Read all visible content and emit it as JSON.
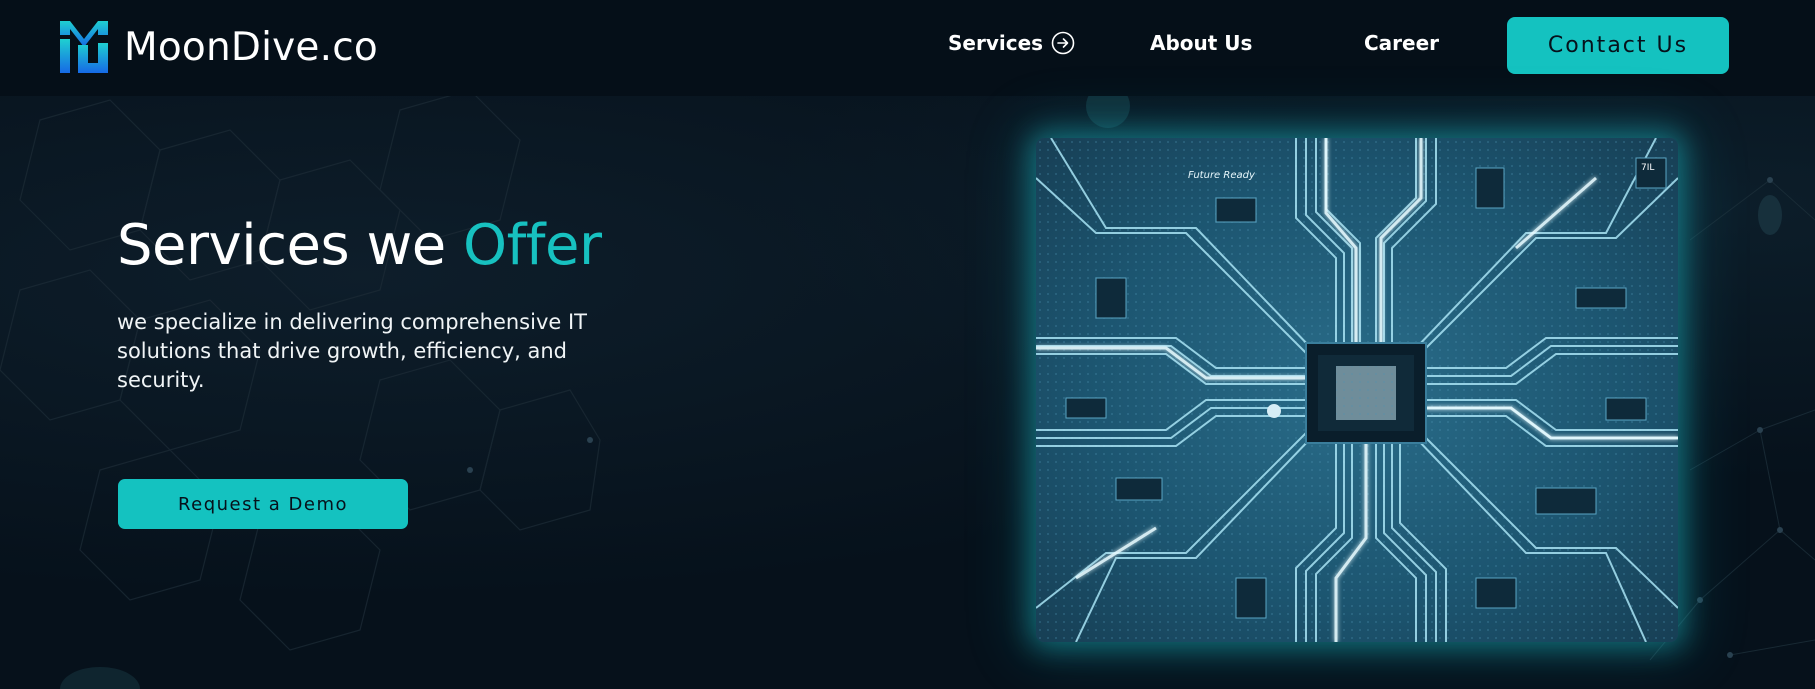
{
  "brand": {
    "name": "MoonDive.co",
    "logo_icon": "moondive-logo-icon"
  },
  "nav": {
    "services": "Services",
    "services_icon": "arrow-circle-right-icon",
    "about": "About Us",
    "career": "Career",
    "contact": "Contact Us"
  },
  "hero": {
    "title_main": "Services we ",
    "title_accent": "Offer",
    "description": "we specialize in delivering comprehensive IT solutions that drive growth, efficiency, and security.",
    "cta": "Request a Demo",
    "image_caption": "Future Ready",
    "image_badge": "7IL"
  },
  "colors": {
    "background": "#06111b",
    "accent": "#14c2c0",
    "text": "#ffffff"
  }
}
